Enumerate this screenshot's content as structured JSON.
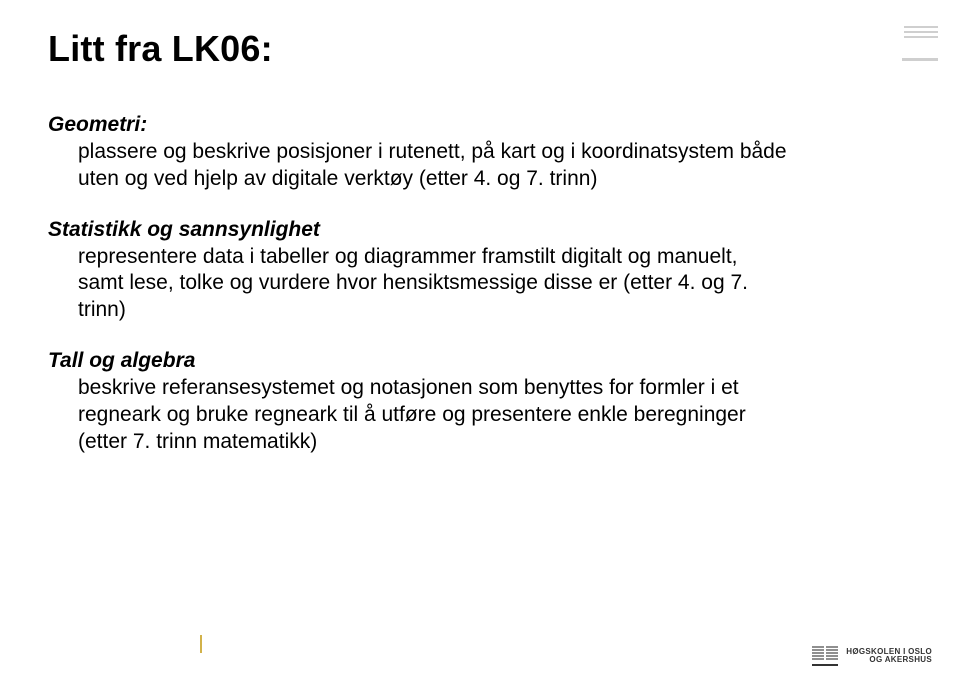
{
  "slide": {
    "title": "Litt fra LK06:",
    "sections": [
      {
        "heading": "Geometri:",
        "body": "plassere og beskrive posisjoner i rutenett, på kart og i koordinatsystem både uten og ved hjelp av digitale verktøy (etter 4. og 7. trinn)"
      },
      {
        "heading": "Statistikk og sannsynlighet",
        "body": "representere data i tabeller og diagrammer framstilt digitalt og manuelt, samt lese, tolke og vurdere hvor hensiktsmessige disse er (etter 4. og 7. trinn)"
      },
      {
        "heading": "Tall og algebra",
        "body": "beskrive referansesystemet og notasjonen som benyttes for formler i et regneark og bruke regneark til å utføre og presentere enkle beregninger\n(etter 7. trinn  matematikk)"
      }
    ]
  },
  "logo": {
    "line1": "HØGSKOLEN I OSLO",
    "line2": "OG AKERSHUS"
  }
}
